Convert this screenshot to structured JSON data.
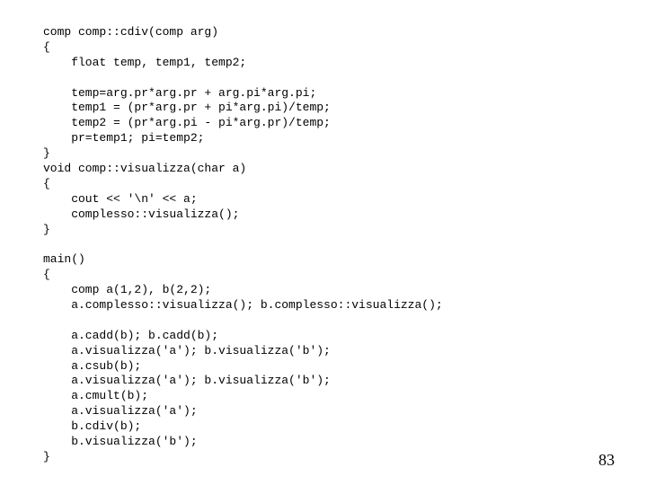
{
  "code": "comp comp::cdiv(comp arg)\n{\n    float temp, temp1, temp2;\n\n    temp=arg.pr*arg.pr + arg.pi*arg.pi;\n    temp1 = (pr*arg.pr + pi*arg.pi)/temp;\n    temp2 = (pr*arg.pi - pi*arg.pr)/temp;\n    pr=temp1; pi=temp2;\n}\nvoid comp::visualizza(char a)\n{\n    cout << '\\n' << a;\n    complesso::visualizza();\n}\n\nmain()\n{\n    comp a(1,2), b(2,2);\n    a.complesso::visualizza(); b.complesso::visualizza();\n\n    a.cadd(b); b.cadd(b);\n    a.visualizza('a'); b.visualizza('b');\n    a.csub(b);\n    a.visualizza('a'); b.visualizza('b');\n    a.cmult(b);\n    a.visualizza('a');\n    b.cdiv(b);\n    b.visualizza('b');\n}",
  "page_number": "83"
}
